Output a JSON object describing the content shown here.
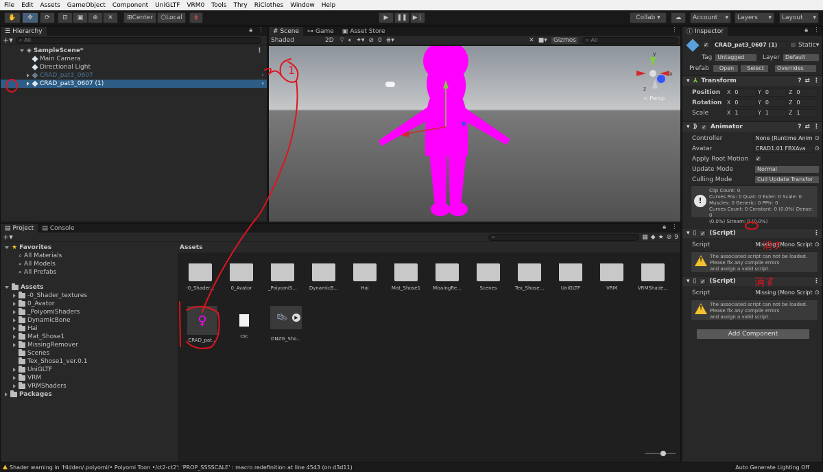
{
  "menu": [
    "File",
    "Edit",
    "Assets",
    "GameObject",
    "Component",
    "UniGLTF",
    "VRM0",
    "Tools",
    "Thry",
    "RiClothes",
    "Window",
    "Help"
  ],
  "toolbar": {
    "center": "Center",
    "local": "Local",
    "collab": "Collab ▾",
    "account": "Account",
    "layers": "Layers",
    "layout": "Layout"
  },
  "hierarchy": {
    "tab": "Hierarchy",
    "search_placeholder": "All",
    "scene": "SampleScene*",
    "items": [
      "Main Camera",
      "Directional Light",
      "CRAD_pat3_0607",
      "CRAD_pat3_0607 (1)"
    ]
  },
  "scene_view": {
    "tabs": [
      "Scene",
      "Game",
      "Asset Store"
    ],
    "shading": "Shaded",
    "mode_2d": "2D",
    "hidden_count": "0",
    "gizmos": "Gizmos",
    "search_placeholder": "All",
    "persp": "< Persp",
    "axes": {
      "x": "x",
      "y": "y",
      "z": "z"
    }
  },
  "project": {
    "tabs": [
      "Project",
      "Console"
    ],
    "favorites_label": "Favorites",
    "favorites": [
      "All Materials",
      "All Models",
      "All Prefabs"
    ],
    "assets_label": "Assets",
    "asset_folders": [
      "-0_Shader_textures",
      "0_Avator",
      "_PoiyomiShaders",
      "DynamicBone",
      "Hai",
      "Mat_Shose1",
      "MissingRemover",
      "Scenes",
      "Tex_Shose1_ver.0.1",
      "UniGLTF",
      "VRM",
      "VRMShaders"
    ],
    "packages_label": "Packages",
    "breadcrumb": "Assets",
    "hidden_count": "9",
    "grid_folders": [
      "-0_Shader...",
      "0_Avator",
      "_PoiyomiS...",
      "DynamicB...",
      "Hai",
      "Mat_Shose1",
      "MissingRe...",
      "Scenes",
      "Tex_Shose...",
      "UniGLTF",
      "VRM",
      "VRMShade..."
    ],
    "grid_files": [
      "CRAD_pat...",
      "csc",
      "DNZG_Sho..."
    ]
  },
  "inspector": {
    "tab": "Inspector",
    "object_name": "CRAD_pat3_0607 (1)",
    "static_label": "Static",
    "tag_label": "Tag",
    "tag_value": "Untagged",
    "layer_label": "Layer",
    "layer_value": "Default",
    "prefab_label": "Prefab",
    "prefab_open": "Open",
    "prefab_select": "Select",
    "prefab_overrides": "Overrides",
    "transform": {
      "title": "Transform",
      "position_label": "Position",
      "rotation_label": "Rotation",
      "scale_label": "Scale",
      "position": [
        "0",
        "0",
        "0"
      ],
      "rotation": [
        "0",
        "0",
        "0"
      ],
      "scale": [
        "1",
        "1",
        "1"
      ]
    },
    "animator": {
      "title": "Animator",
      "controller_label": "Controller",
      "controller_value": "None (Runtime Anima",
      "avatar_label": "Avatar",
      "avatar_value": "CRAD1.01 FBXAva",
      "apply_root_label": "Apply Root Motion",
      "update_label": "Update Mode",
      "update_value": "Normal",
      "culling_label": "Culling Mode",
      "culling_value": "Cull Update Transfor",
      "info": [
        "Clip Count: 0",
        "Curves Pos: 0 Quat: 0 Euler: 0 Scale: 0",
        "Muscles: 0 Generic: 0 PPtr: 0",
        "Curves Count: 0 Constant: 0 (0.0%) Dense: 0",
        "(0.0%) Stream: 0 (0.0%)"
      ]
    },
    "script_title": "(Script)",
    "script_label": "Script",
    "script_value": "Missing (Mono Script",
    "script_warning": [
      "The associated script can not be loaded.",
      "Please fix any compile errors",
      "and assign a valid script."
    ],
    "add_component": "Add Component"
  },
  "status": {
    "message": "Shader warning in 'Hidden/.poiyomi/• Poiyomi Toon •/ct2-ct2': 'PROP_SSSSCALE' : macro redefinition at line 4543 (on d3d11)",
    "right": "Auto Generate Lighting Off"
  },
  "annotations": {
    "circle_one": "1",
    "erase_1": "消す",
    "erase_2": "消す"
  },
  "colors": {
    "selection": "#2c5d87",
    "avatar_magenta": "#ff00ff",
    "annotation_red": "#e0141e",
    "warning_yellow": "#f2c12e"
  }
}
